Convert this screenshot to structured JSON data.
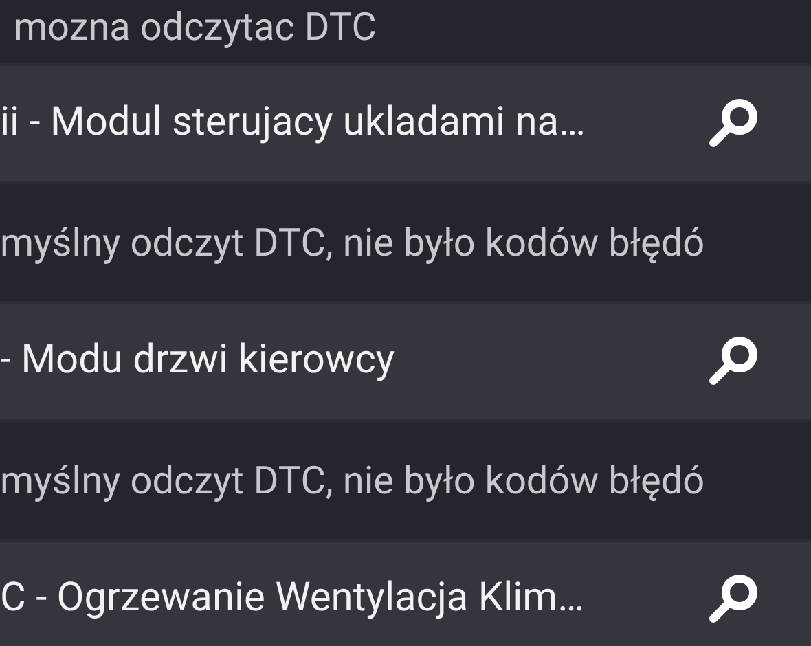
{
  "rows": [
    {
      "kind": "status",
      "text": "mozna odczytac DTC"
    },
    {
      "kind": "module",
      "text": "ii - Modul sterujacy ukladami na…"
    },
    {
      "kind": "status",
      "text": "myślny odczyt DTC, nie było kodów błędó"
    },
    {
      "kind": "module",
      "text": "- Modu drzwi kierowcy"
    },
    {
      "kind": "status",
      "text": "myślny odczyt DTC, nie było kodów błędó"
    },
    {
      "kind": "module",
      "text": "C - Ogrzewanie Wentylacja Klim…"
    }
  ]
}
